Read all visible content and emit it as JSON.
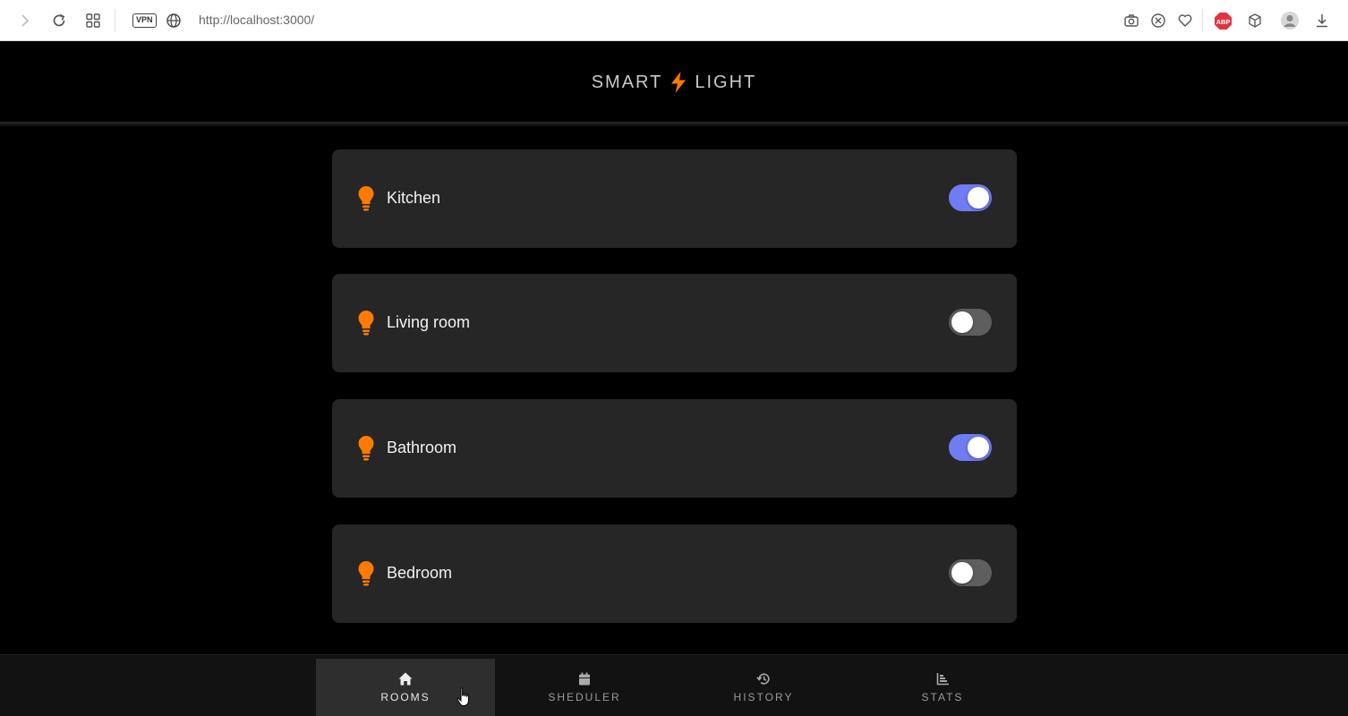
{
  "browser": {
    "url": "http://localhost:3000/",
    "vpn_label": "VPN",
    "adblock_label": "ABP"
  },
  "app": {
    "title_left": "SMART",
    "title_right": "LIGHT",
    "title_icon": "lightning-bolt-icon",
    "accent_color": "#ff7a00",
    "toggle_on_color": "#6f7cf2",
    "toggle_off_color": "#5e5e5e"
  },
  "rooms": [
    {
      "name": "Kitchen",
      "on": true
    },
    {
      "name": "Living room",
      "on": false
    },
    {
      "name": "Bathroom",
      "on": true
    },
    {
      "name": "Bedroom",
      "on": false
    }
  ],
  "nav": [
    {
      "label": "ROOMS",
      "icon": "home-icon",
      "active": true
    },
    {
      "label": "SHEDULER",
      "icon": "calendar-icon",
      "active": false
    },
    {
      "label": "HISTORY",
      "icon": "history-icon",
      "active": false
    },
    {
      "label": "STATS",
      "icon": "chart-icon",
      "active": false
    }
  ]
}
